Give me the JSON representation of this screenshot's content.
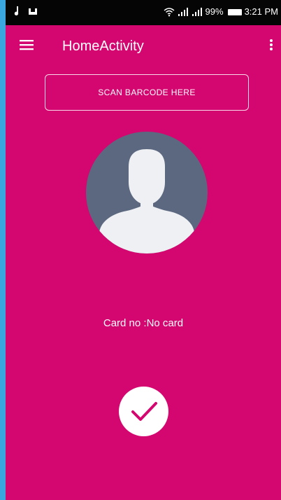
{
  "status_bar": {
    "music_icon": "music-note-icon",
    "notification_icon": "notification-icon",
    "wifi_icon": "wifi-icon",
    "signal_icon_1": "signal-icon",
    "signal_icon_2": "signal-icon",
    "battery_percent": "99%",
    "time": "3:21 PM"
  },
  "app_bar": {
    "title": "HomeActivity",
    "menu_icon": "hamburger-menu-icon",
    "overflow_icon": "overflow-menu-icon"
  },
  "main": {
    "scan_button_label": "SCAN BARCODE HERE",
    "avatar_icon": "person-avatar-icon",
    "card_text": "Card no :No card",
    "confirm_icon": "checkmark-icon"
  },
  "colors": {
    "background": "#3aa8df",
    "primary": "#d4066f",
    "avatar_bg": "#5b6880",
    "avatar_fg": "#eef0f3",
    "text": "#ffffff",
    "status_bar": "#050505"
  }
}
